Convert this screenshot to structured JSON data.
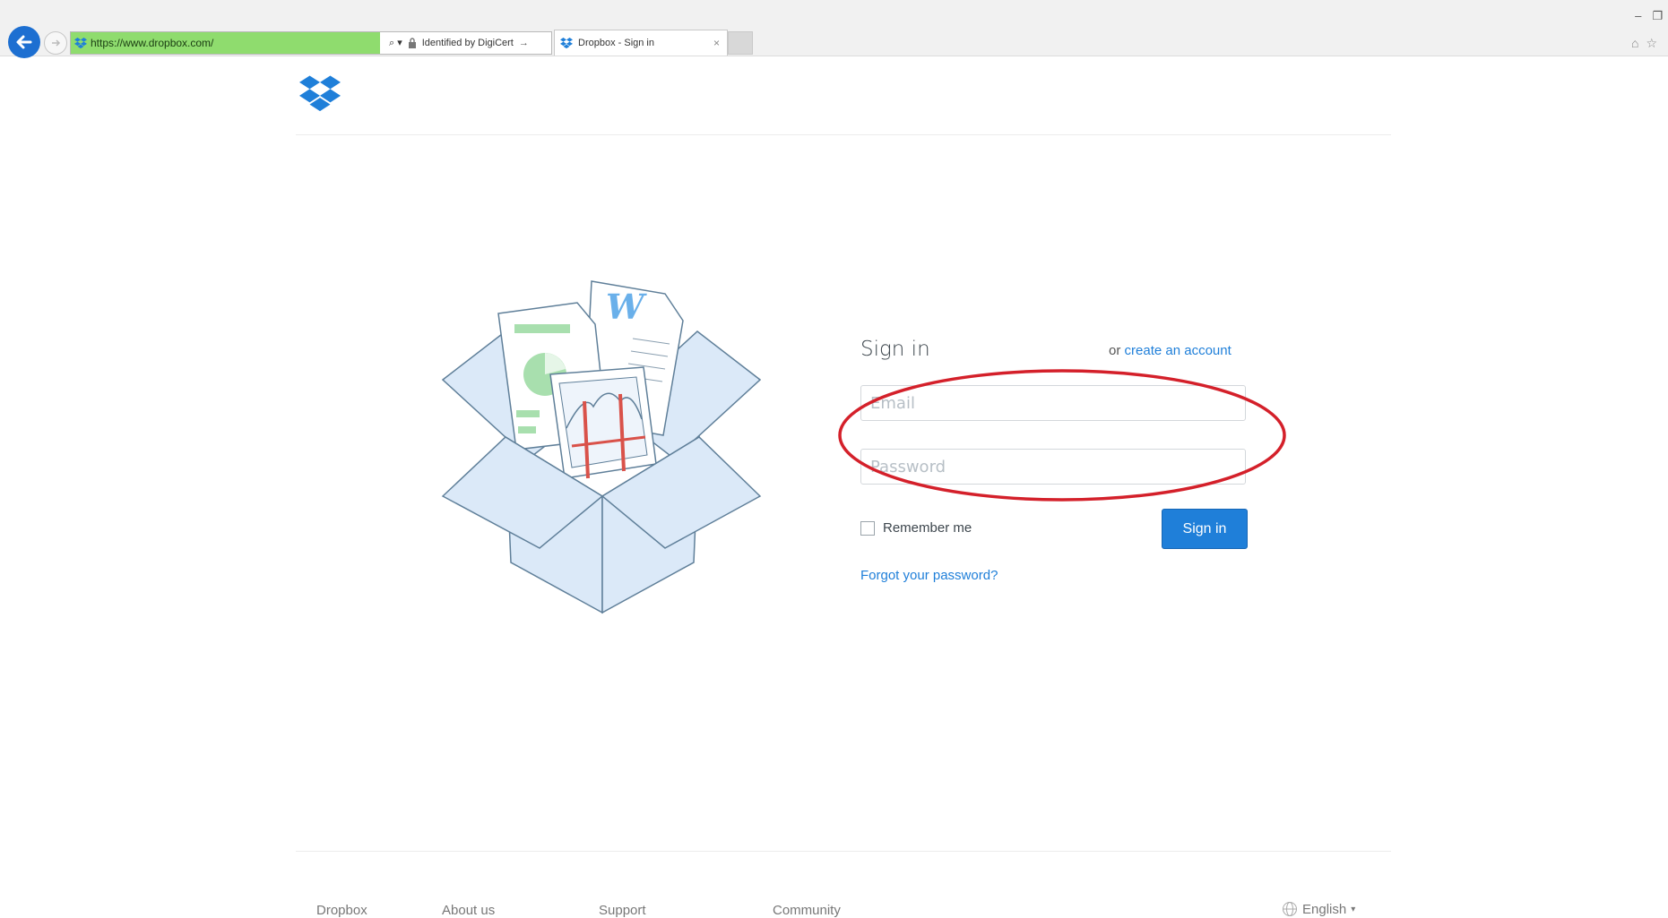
{
  "browser": {
    "url": "https://www.dropbox.com/",
    "cert_label": "Identified by DigiCert",
    "tab_title": "Dropbox - Sign in",
    "tab_close": "×",
    "win_minimize": "–",
    "win_restore": "❐",
    "home": "⌂",
    "favorite": "☆",
    "search_glyph": "⌕ ▾"
  },
  "page": {
    "signin_title": "Sign in",
    "or_text": "or ",
    "create_account_link": "create an account",
    "email_placeholder": "Email",
    "password_placeholder": "Password",
    "remember_label": "Remember me",
    "signin_button": "Sign in",
    "forgot_link": "Forgot your password?"
  },
  "footer": {
    "links": [
      "Dropbox",
      "About us",
      "Support",
      "Community"
    ],
    "language": "English",
    "language_caret": "▾"
  },
  "colors": {
    "brand_blue": "#1f7fd9",
    "annotation_red": "#d4202a",
    "cert_green": "#8fdc6e"
  },
  "icons": {
    "back": "back-arrow-icon",
    "forward": "forward-arrow-icon",
    "lock": "lock-icon",
    "logo": "dropbox-logo-icon",
    "globe": "globe-icon"
  }
}
